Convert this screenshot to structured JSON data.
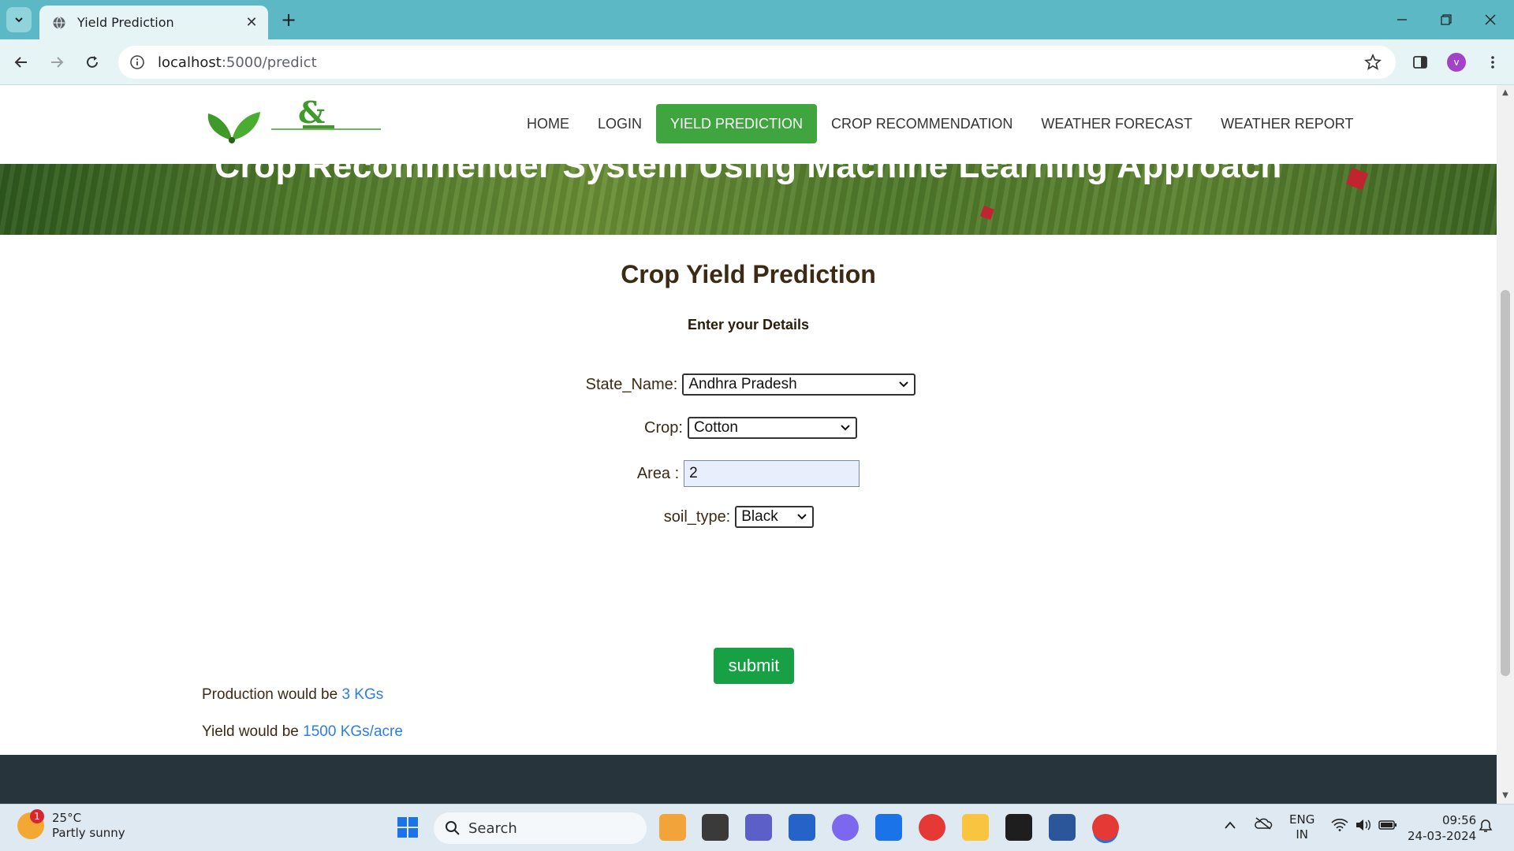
{
  "browser": {
    "tab_title": "Yield Prediction",
    "url_host": "localhost",
    "url_path": ":5000/predict",
    "profile_initial": "v",
    "tab_close": "✕",
    "new_tab": "+"
  },
  "nav": {
    "items": [
      "HOME",
      "LOGIN",
      "YIELD PREDICTION",
      "CROP RECOMMENDATION",
      "WEATHER FORECAST",
      "WEATHER REPORT"
    ],
    "active_index": 2
  },
  "hero": {
    "title": "Crop Recommender System Using Machine Learning Approach"
  },
  "main": {
    "title": "Crop Yield Prediction",
    "subtitle": "Enter your Details",
    "state_label": "State_Name:",
    "state_value": "Andhra Pradesh",
    "crop_label": "Crop:",
    "crop_value": "Cotton",
    "area_label": "Area :",
    "area_value": "2",
    "soil_label": "soil_type:",
    "soil_value": "Black",
    "submit_label": "submit"
  },
  "results": {
    "production_prefix": "Production would be",
    "production_value": "3 KGs",
    "yield_prefix": "Yield would be",
    "yield_value": "1500 KGs/acre"
  },
  "taskbar": {
    "temperature": "25°C",
    "weather": "Partly sunny",
    "weather_badge": "1",
    "search_placeholder": "Search",
    "lang_top": "ENG",
    "lang_bottom": "IN",
    "time": "09:56",
    "date": "24-03-2024"
  },
  "colors": {
    "accent_green": "#3ea53f",
    "submit_green": "#17a144",
    "result_blue": "#2b7de9",
    "chrome_teal": "#5bb8c4"
  }
}
